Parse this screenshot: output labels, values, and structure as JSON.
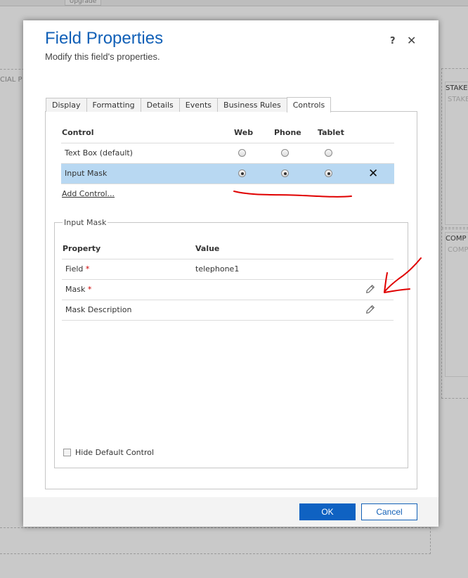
{
  "background": {
    "upgrade_label": "Upgrade",
    "left_section_label": "CIAL P",
    "right_section1_label": "STAKE",
    "right_section1_placeholder": "STAKE",
    "right_section2_label": "COMP",
    "right_section2_placeholder": "COMP"
  },
  "dialog": {
    "title": "Field Properties",
    "subtitle": "Modify this field's properties.",
    "help_label": "?",
    "close_label": "✕"
  },
  "tabs": [
    {
      "label": "Display",
      "active": false
    },
    {
      "label": "Formatting",
      "active": false
    },
    {
      "label": "Details",
      "active": false
    },
    {
      "label": "Events",
      "active": false
    },
    {
      "label": "Business Rules",
      "active": false
    },
    {
      "label": "Controls",
      "active": true
    }
  ],
  "controls_table": {
    "headers": {
      "control": "Control",
      "web": "Web",
      "phone": "Phone",
      "tablet": "Tablet"
    },
    "rows": [
      {
        "name": "Text Box (default)",
        "web": false,
        "phone": false,
        "tablet": false,
        "selected": false
      },
      {
        "name": "Input Mask",
        "web": true,
        "phone": true,
        "tablet": true,
        "selected": true
      }
    ],
    "remove_label": "✕",
    "add_control_label": "Add Control..."
  },
  "input_mask": {
    "legend": "Input Mask",
    "headers": {
      "property": "Property",
      "value": "Value"
    },
    "rows": [
      {
        "property": "Field",
        "required": true,
        "value": "telephone1",
        "editable": false
      },
      {
        "property": "Mask",
        "required": true,
        "value": "",
        "editable": true
      },
      {
        "property": "Mask Description",
        "required": false,
        "value": "",
        "editable": true
      }
    ],
    "required_marker": "*",
    "hide_default_label": "Hide Default Control",
    "hide_default_checked": false
  },
  "buttons": {
    "ok_label": "OK",
    "cancel_label": "Cancel"
  },
  "colors": {
    "accent": "#1160b7",
    "primary_button": "#0f62c2",
    "selected_row": "#b8d8f2",
    "annotation": "#e00000"
  },
  "icons": {
    "edit": "pencil-icon",
    "remove": "close-icon"
  }
}
